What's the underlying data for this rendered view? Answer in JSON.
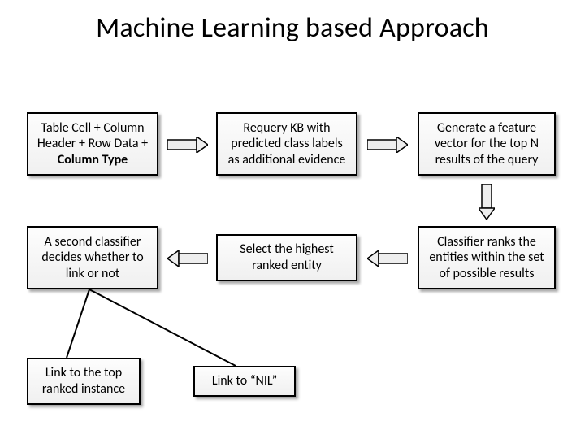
{
  "title": "Machine Learning based Approach",
  "boxes": {
    "b1": {
      "pre": "Table Cell + Column Header + Row Data + ",
      "bold": "Column Type"
    },
    "b2": "Requery KB with predicted class labels as additional evidence",
    "b3": "Generate a feature vector for the top N results of the query",
    "b4": "A second classifier decides whether to link or not",
    "b5": "Select the highest ranked entity",
    "b6": "Classifier ranks the entities within the set of possible results",
    "b7": "Link to the top ranked instance",
    "b8": "Link to “NIL”"
  }
}
